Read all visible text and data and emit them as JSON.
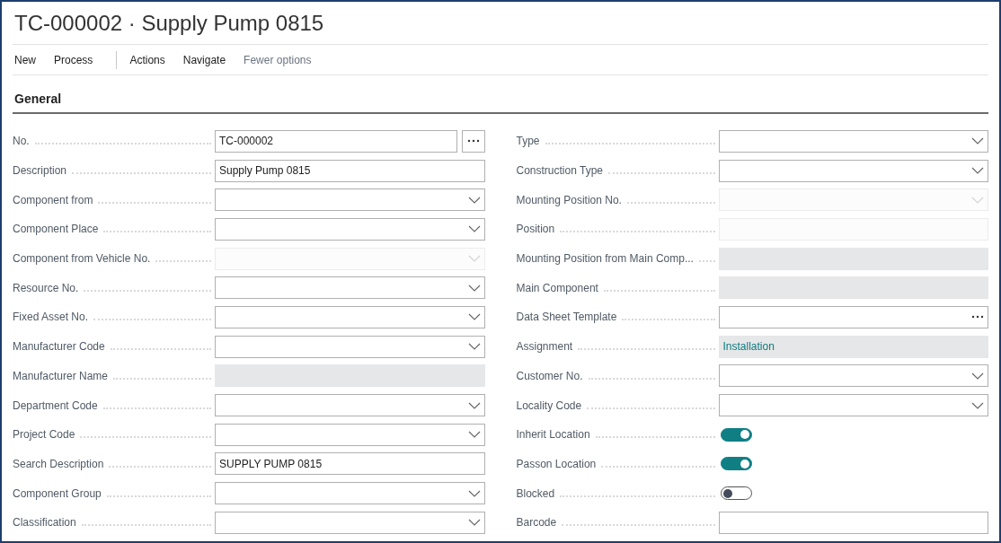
{
  "window": {
    "title": "TC-000002 · Supply Pump 0815"
  },
  "actions": [
    {
      "label": "New",
      "kind": "action"
    },
    {
      "label": "Process",
      "kind": "action"
    },
    {
      "kind": "separator"
    },
    {
      "label": "Actions",
      "kind": "action"
    },
    {
      "label": "Navigate",
      "kind": "action"
    },
    {
      "label": "Fewer options",
      "kind": "toggle_link"
    }
  ],
  "section": {
    "title": "General"
  },
  "columns": [
    [
      {
        "label": "No.",
        "kind": "assist_button",
        "value": "TC-000002",
        "disabled": false
      },
      {
        "label": "Description",
        "kind": "text",
        "value": "Supply Pump 0815",
        "disabled": false
      },
      {
        "label": "Component from",
        "kind": "select",
        "disabled": false
      },
      {
        "label": "Component Place",
        "kind": "select",
        "disabled": false
      },
      {
        "label": "Component from Vehicle No.",
        "kind": "select",
        "disabled": true
      },
      {
        "label": "Resource No.",
        "kind": "select",
        "disabled": false
      },
      {
        "label": "Fixed Asset No.",
        "kind": "select",
        "disabled": false
      },
      {
        "label": "Manufacturer Code",
        "kind": "select",
        "disabled": false
      },
      {
        "label": "Manufacturer Name",
        "kind": "readonly"
      },
      {
        "label": "Department Code",
        "kind": "select",
        "disabled": false
      },
      {
        "label": "Project Code",
        "kind": "select",
        "disabled": false
      },
      {
        "label": "Search Description",
        "kind": "text",
        "value": "SUPPLY PUMP 0815",
        "disabled": false
      },
      {
        "label": "Component Group",
        "kind": "select",
        "disabled": false
      },
      {
        "label": "Classification",
        "kind": "select",
        "disabled": false
      }
    ],
    [
      {
        "label": "Type",
        "kind": "select",
        "disabled": false
      },
      {
        "label": "Construction Type",
        "kind": "select",
        "disabled": false
      },
      {
        "label": "Mounting Position No.",
        "kind": "select",
        "disabled": true
      },
      {
        "label": "Position",
        "kind": "text",
        "disabled": true
      },
      {
        "label": "Mounting Position from Main Comp...",
        "kind": "readonly"
      },
      {
        "label": "Main Component",
        "kind": "readonly"
      },
      {
        "label": "Data Sheet Template",
        "kind": "assist_inline",
        "disabled": false
      },
      {
        "label": "Assignment",
        "kind": "readonly",
        "value": "Installation"
      },
      {
        "label": "Customer No.",
        "kind": "select",
        "disabled": false
      },
      {
        "label": "Locality Code",
        "kind": "select",
        "disabled": false
      },
      {
        "label": "Inherit Location",
        "kind": "toggle",
        "on": true
      },
      {
        "label": "Passon Location",
        "kind": "toggle",
        "on": true
      },
      {
        "label": "Blocked",
        "kind": "toggle",
        "on": false
      },
      {
        "label": "Barcode",
        "kind": "text",
        "disabled": false
      }
    ]
  ]
}
